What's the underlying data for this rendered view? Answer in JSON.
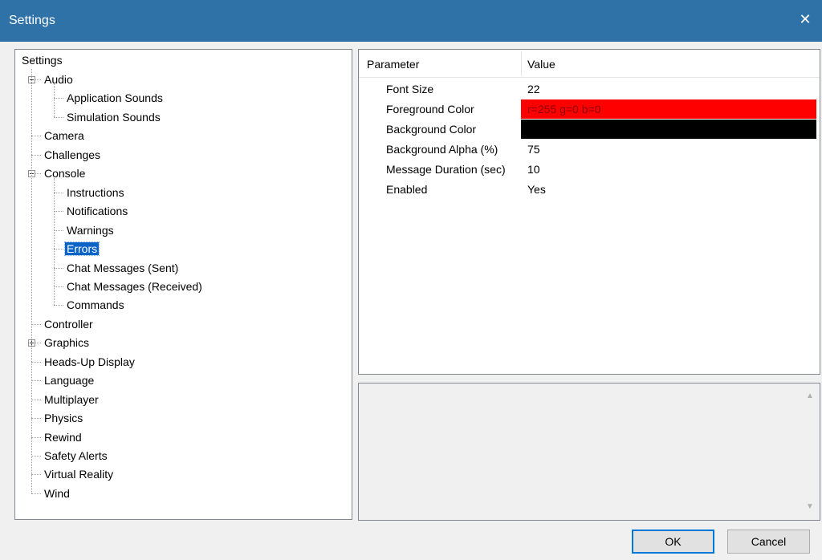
{
  "window": {
    "title": "Settings",
    "close_glyph": "✕"
  },
  "tree": {
    "root": "Settings",
    "items": [
      {
        "label": "Audio",
        "level": 1,
        "expander": "minus"
      },
      {
        "label": "Application Sounds",
        "level": 2
      },
      {
        "label": "Simulation Sounds",
        "level": 2
      },
      {
        "label": "Camera",
        "level": 1
      },
      {
        "label": "Challenges",
        "level": 1
      },
      {
        "label": "Console",
        "level": 1,
        "expander": "minus"
      },
      {
        "label": "Instructions",
        "level": 2
      },
      {
        "label": "Notifications",
        "level": 2
      },
      {
        "label": "Warnings",
        "level": 2
      },
      {
        "label": "Errors",
        "level": 2,
        "selected": true
      },
      {
        "label": "Chat Messages (Sent)",
        "level": 2
      },
      {
        "label": "Chat Messages (Received)",
        "level": 2
      },
      {
        "label": "Commands",
        "level": 2
      },
      {
        "label": "Controller",
        "level": 1
      },
      {
        "label": "Graphics",
        "level": 1,
        "expander": "plus"
      },
      {
        "label": "Heads-Up Display",
        "level": 1
      },
      {
        "label": "Language",
        "level": 1
      },
      {
        "label": "Multiplayer",
        "level": 1
      },
      {
        "label": "Physics",
        "level": 1
      },
      {
        "label": "Rewind",
        "level": 1
      },
      {
        "label": "Safety Alerts",
        "level": 1
      },
      {
        "label": "Virtual Reality",
        "level": 1
      },
      {
        "label": "Wind",
        "level": 1
      }
    ]
  },
  "grid": {
    "headers": {
      "parameter": "Parameter",
      "value": "Value"
    },
    "rows": [
      {
        "param": "Font Size",
        "value": "22"
      },
      {
        "param": "Foreground Color",
        "value": "r=255 g=0 b=0",
        "bg": "#ff0000",
        "fg": "#8b0000"
      },
      {
        "param": "Background Color",
        "value": "",
        "bg": "#000000"
      },
      {
        "param": "Background Alpha (%)",
        "value": "75"
      },
      {
        "param": "Message Duration (sec)",
        "value": "10"
      },
      {
        "param": "Enabled",
        "value": "Yes"
      }
    ]
  },
  "buttons": {
    "ok": "OK",
    "cancel": "Cancel"
  },
  "colors": {
    "titlebar": "#2e72a8",
    "selection": "#0a64c8",
    "focus_border": "#0078d7"
  }
}
